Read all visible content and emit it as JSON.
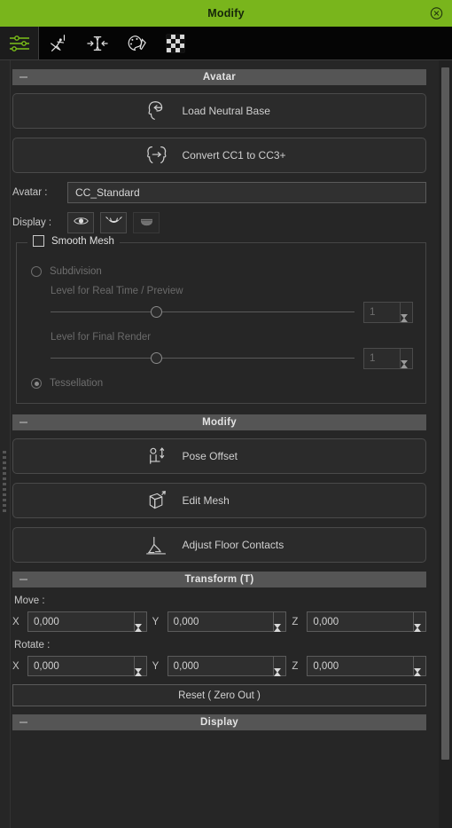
{
  "window": {
    "title": "Modify",
    "close_icon": "close-circle-icon",
    "accent_color": "#79b51c"
  },
  "toolbar": {
    "items": [
      {
        "name": "sliders-icon",
        "label": "Modify",
        "active": true
      },
      {
        "name": "pose-figure-icon",
        "label": "Pose",
        "active": false
      },
      {
        "name": "fit-constrain-icon",
        "label": "Fit",
        "active": false
      },
      {
        "name": "palette-icon",
        "label": "Material",
        "active": false
      },
      {
        "name": "checkerboard-icon",
        "label": "Texture",
        "active": false
      }
    ]
  },
  "sections": {
    "avatar": {
      "title": "Avatar",
      "collapse_icon": "minus-icon",
      "buttons": [
        {
          "label": "Load Neutral Base",
          "icon": "head-load-icon"
        },
        {
          "label": "Convert CC1 to CC3+",
          "icon": "head-convert-icon"
        }
      ],
      "avatar_field": {
        "label": "Avatar :",
        "value": "CC_Standard",
        "placeholder": "CC_Standard"
      },
      "display_row": {
        "label": "Display :",
        "toggles": [
          {
            "icon": "eye-icon",
            "dim": false
          },
          {
            "icon": "eyelash-icon",
            "dim": false
          },
          {
            "icon": "tongue-icon",
            "dim": true
          }
        ]
      },
      "smooth_mesh": {
        "legend": "Smooth Mesh",
        "checked": false,
        "options": [
          {
            "label": "Subdivision",
            "selected": false
          },
          {
            "label": "Tessellation",
            "selected": true
          }
        ],
        "sliders": [
          {
            "label": "Level for Real Time / Preview",
            "value": "1",
            "percent": 34
          },
          {
            "label": "Level for Final Render",
            "value": "1",
            "percent": 34
          }
        ]
      }
    },
    "modify": {
      "title": "Modify",
      "collapse_icon": "minus-icon",
      "buttons": [
        {
          "label": "Pose Offset",
          "icon": "pose-offset-icon"
        },
        {
          "label": "Edit Mesh",
          "icon": "edit-mesh-icon"
        },
        {
          "label": "Adjust Floor Contacts",
          "icon": "floor-contact-icon"
        }
      ]
    },
    "transform": {
      "title": "Transform  (T)",
      "collapse_icon": "minus-icon",
      "move": {
        "label": "Move :",
        "axes": [
          {
            "axis": "X",
            "value": "0,000"
          },
          {
            "axis": "Y",
            "value": "0,000"
          },
          {
            "axis": "Z",
            "value": "0,000"
          }
        ]
      },
      "rotate": {
        "label": "Rotate :",
        "axes": [
          {
            "axis": "X",
            "value": "0,000"
          },
          {
            "axis": "Y",
            "value": "0,000"
          },
          {
            "axis": "Z",
            "value": "0,000"
          }
        ]
      },
      "reset_label": "Reset ( Zero Out )"
    },
    "display": {
      "title": "Display",
      "collapse_icon": "minus-icon"
    }
  }
}
